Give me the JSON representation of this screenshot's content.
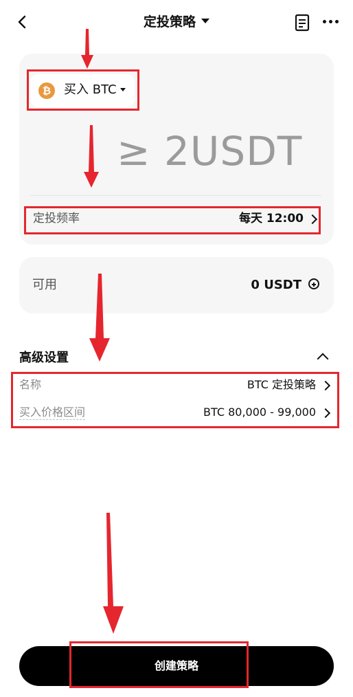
{
  "header": {
    "title": "定投策略",
    "back_icon": "chevron-left-icon",
    "doc_icon": "document-icon",
    "more_icon": "more-dots-icon"
  },
  "buy_card": {
    "coin_symbol_icon": "bitcoin-icon",
    "buy_label": "买入 BTC",
    "amount_placeholder": "≥ 2USDT",
    "frequency_label": "定投频率",
    "frequency_value": "每天 12:00"
  },
  "available": {
    "label": "可用",
    "value": "0 USDT"
  },
  "advanced": {
    "title": "高级设置",
    "rows": [
      {
        "label": "名称",
        "value": "BTC 定投策略"
      },
      {
        "label": "买入价格区间",
        "value": "BTC 80,000 - 99,000"
      }
    ]
  },
  "footer": {
    "create_label": "创建策略"
  },
  "colors": {
    "accent_btc": "#e8993f",
    "annotation_red": "#e5262e",
    "card_bg": "#f6f6f6"
  }
}
